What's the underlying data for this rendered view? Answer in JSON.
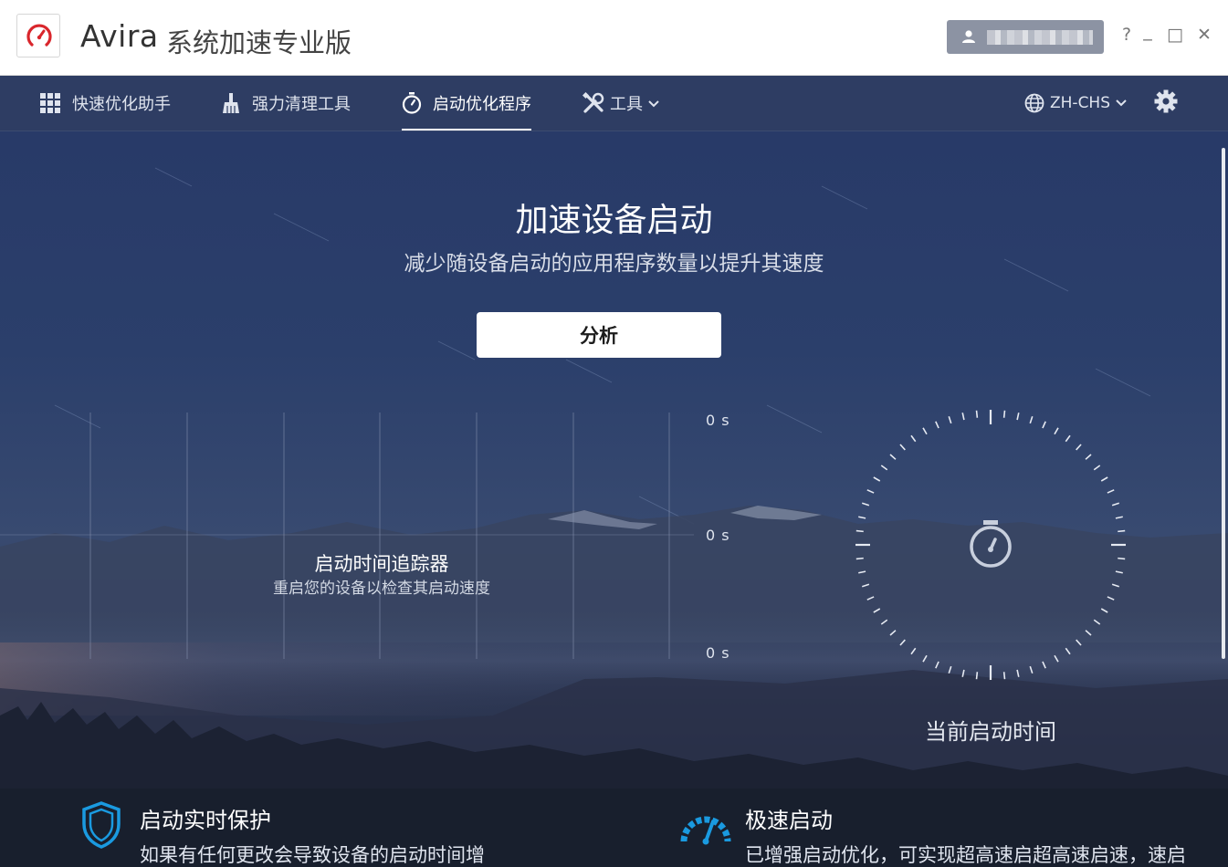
{
  "window": {
    "app_name": "Avira",
    "product_name": "系统加速专业版",
    "user_name_blurred": "",
    "help_label": "?",
    "minimize_label": "_",
    "maximize_label": "□",
    "close_label": "✕"
  },
  "nav": {
    "items": [
      {
        "label": "快速优化助手",
        "icon": "grid-icon"
      },
      {
        "label": "强力清理工具",
        "icon": "broom-icon"
      },
      {
        "label": "启动优化程序",
        "icon": "stopwatch-icon",
        "active": true
      },
      {
        "label": "工具",
        "icon": "tools-icon"
      }
    ],
    "language": "ZH-CHS",
    "settings_icon": "gear-icon"
  },
  "main": {
    "headline": "加速设备启动",
    "subline": "减少随设备启动的应用程序数量以提升其速度",
    "analyze_button": "分析",
    "chart": {
      "axis_labels": [
        "0 s",
        "0 s",
        "0 s"
      ],
      "title": "启动时间追踪器",
      "subtitle": "重启您的设备以检查其启动速度"
    },
    "dial": {
      "label": "当前启动时间"
    },
    "features": [
      {
        "title": "启动实时保护",
        "desc": "如果有任何更改会导致设备的启动时间增",
        "icon": "shield-icon"
      },
      {
        "title": "极速启动",
        "desc": "已增强启动优化，可实现超高速启超高速启速，速启",
        "icon": "speedometer-icon"
      }
    ]
  },
  "colors": {
    "brand_red": "#d9262c",
    "nav_bg": "#2e3d63",
    "accent_blue": "#1a9ae0"
  }
}
